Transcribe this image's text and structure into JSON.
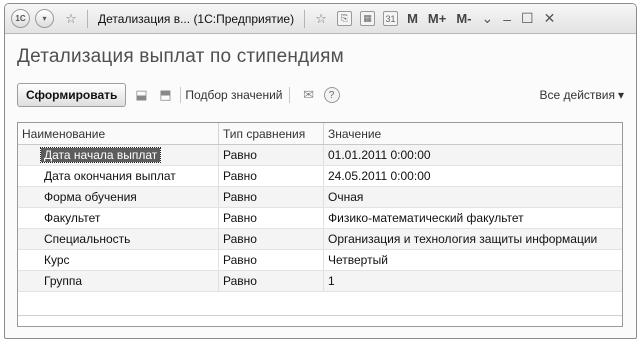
{
  "titlebar": {
    "logo_text": "1С",
    "title": "Детализация в... (1С:Предприятие)",
    "m_label": "M",
    "mplus_label": "M+",
    "mminus_label": "M-"
  },
  "page": {
    "title": "Детализация выплат по стипендиям"
  },
  "toolbar": {
    "generate_label": "Сформировать",
    "select_values_label": "Подбор значений",
    "all_actions_label": "Все действия"
  },
  "table": {
    "headers": [
      "Наименование",
      "Тип сравнения",
      "Значение"
    ],
    "rows": [
      {
        "name": "Дата начала выплат",
        "comparison": "Равно",
        "value": "01.01.2011 0:00:00"
      },
      {
        "name": "Дата окончания выплат",
        "comparison": "Равно",
        "value": "24.05.2011 0:00:00"
      },
      {
        "name": "Форма обучения",
        "comparison": "Равно",
        "value": "Очная"
      },
      {
        "name": "Факультет",
        "comparison": "Равно",
        "value": "Физико-математический факультет"
      },
      {
        "name": "Специальность",
        "comparison": "Равно",
        "value": "Организация и технология защиты информации"
      },
      {
        "name": "Курс",
        "comparison": "Равно",
        "value": "Четвертый"
      },
      {
        "name": "Группа",
        "comparison": "Равно",
        "value": "1"
      }
    ]
  },
  "icons": {
    "app_menu": "1c-logo-icon",
    "dropdown": "chevron-down-icon",
    "favorite": "star-icon"
  }
}
